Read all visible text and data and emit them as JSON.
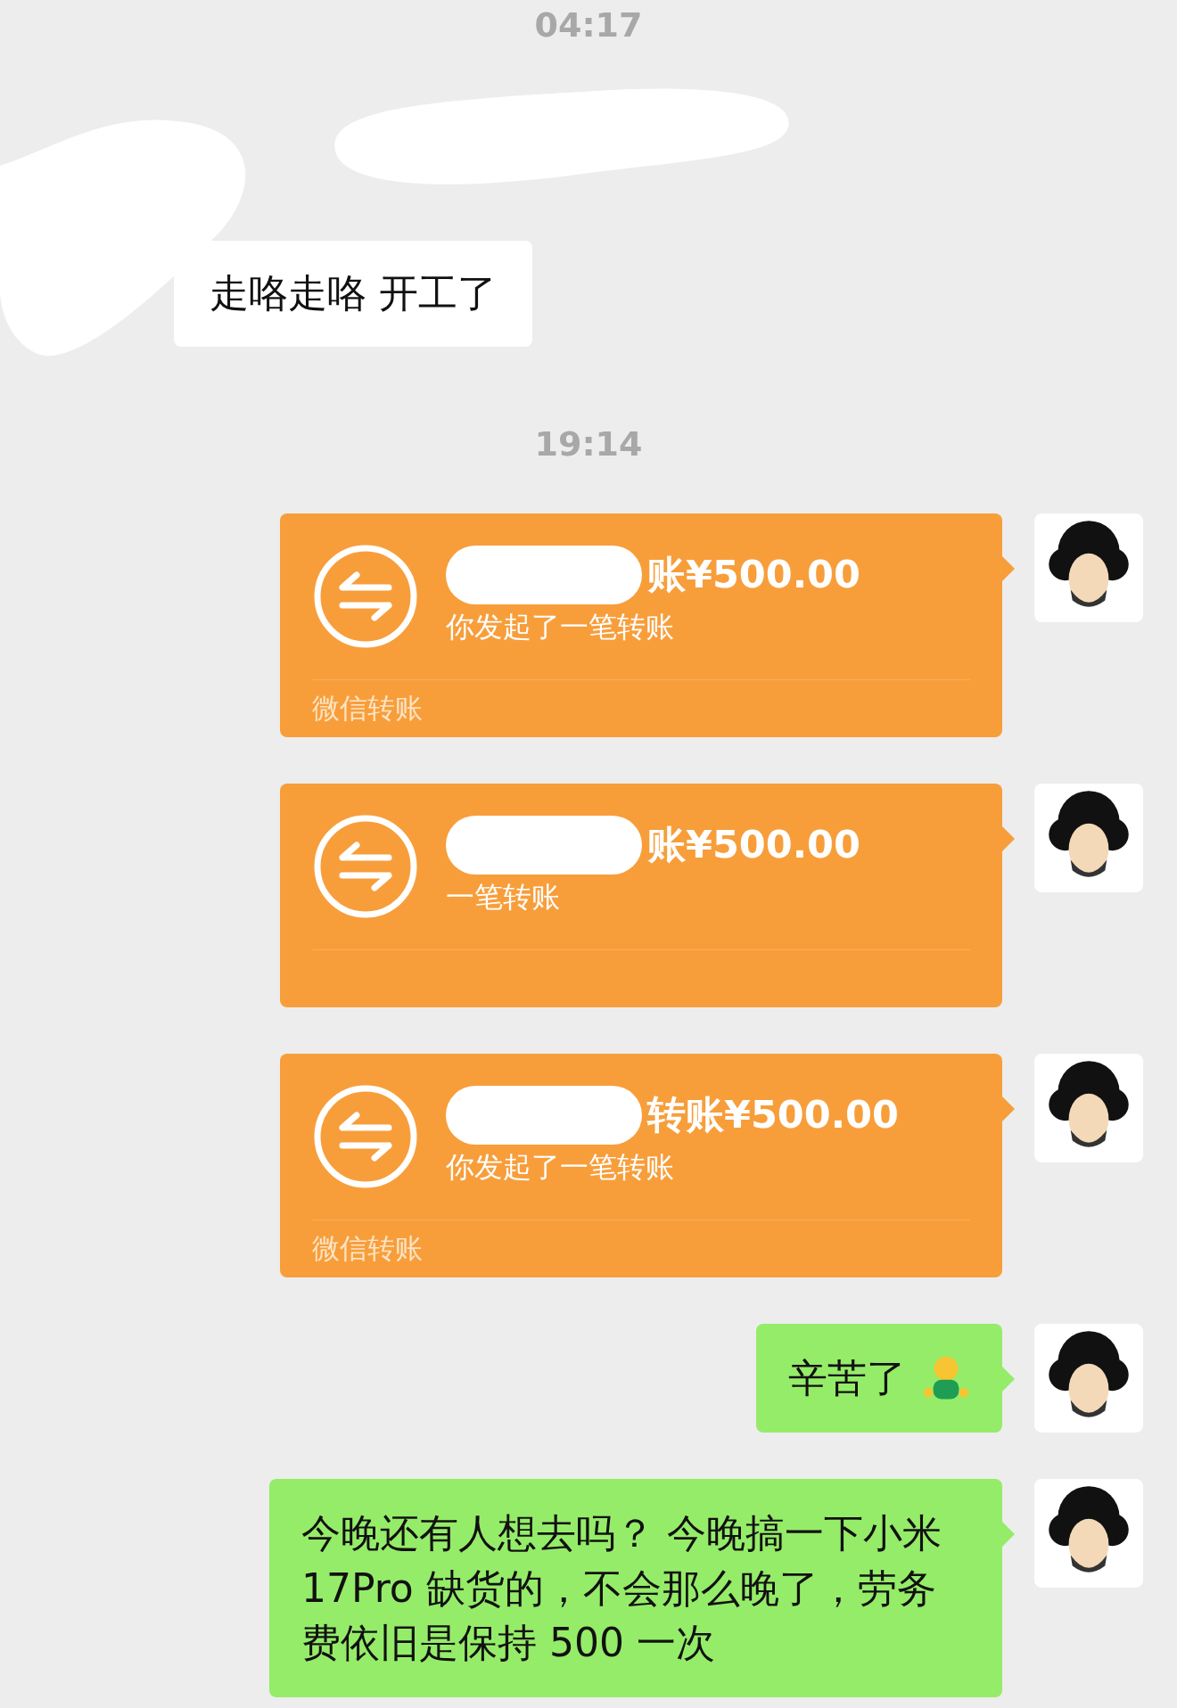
{
  "messages": [
    {
      "kind": "time",
      "text": "04:17"
    },
    {
      "kind": "incoming",
      "text": "走咯走咯 开工了"
    },
    {
      "kind": "time",
      "text": "19:14"
    },
    {
      "kind": "transfer",
      "title": "账¥500.00",
      "subtitle": "你发起了一笔转账",
      "footer": "微信转账"
    },
    {
      "kind": "transfer",
      "title": "账¥500.00",
      "subtitle": "一笔转账"
    },
    {
      "kind": "transfer",
      "title": "转账¥500.00",
      "subtitle": "你发起了一笔转账",
      "footer": "微信转账"
    },
    {
      "kind": "outgoing",
      "text": "辛苦了",
      "emoji": true
    },
    {
      "kind": "outgoing",
      "text": "今晚还有人想去吗？ 今晚搞一下小米17Pro 缺货的，不会那么晚了，劳务费依旧是保持 500 一次"
    }
  ]
}
